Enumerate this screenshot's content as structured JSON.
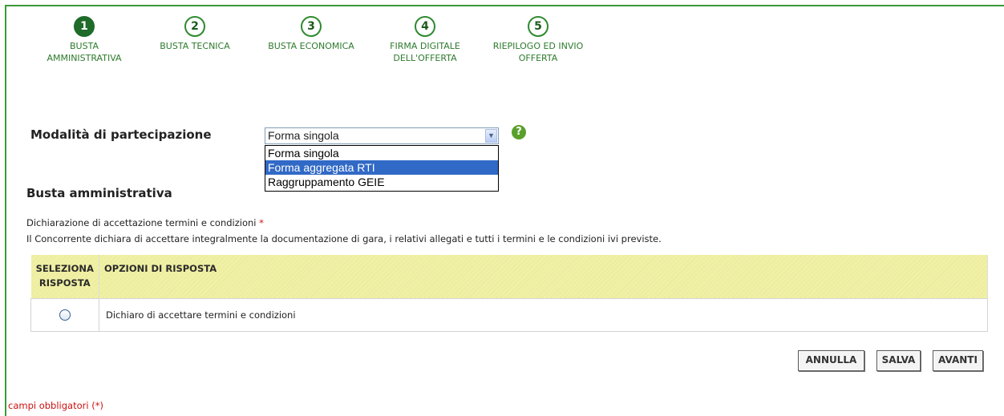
{
  "steps": [
    {
      "number": "1",
      "label": "BUSTA AMMINISTRATIVA",
      "active": true
    },
    {
      "number": "2",
      "label": "BUSTA TECNICA",
      "active": false
    },
    {
      "number": "3",
      "label": "BUSTA ECONOMICA",
      "active": false
    },
    {
      "number": "4",
      "label": "FIRMA DIGITALE DELL'OFFERTA",
      "active": false
    },
    {
      "number": "5",
      "label": "RIEPILOGO ED INVIO OFFERTA",
      "active": false
    }
  ],
  "participation": {
    "label": "Modalità di partecipazione",
    "selected": "Forma singola",
    "options": [
      "Forma singola",
      "Forma aggregata RTI",
      "Raggruppamento GEIE"
    ],
    "highlighted": "Forma aggregata RTI",
    "help_icon": "question-icon"
  },
  "section": {
    "title": "Busta amministrativa",
    "declaration_title": "Dichiarazione di accettazione termini e condizioni",
    "required_mark": "*",
    "declaration_text": "Il Concorrente dichiara di accettare integralmente la documentazione di gara, i relativi allegati e tutti i termini e le condizioni ivi previste."
  },
  "table": {
    "headers": [
      "SELEZIONA RISPOSTA",
      "OPZIONI DI RISPOSTA"
    ],
    "rows": [
      {
        "option": "Dichiaro di accettare termini e condizioni"
      }
    ]
  },
  "buttons": {
    "cancel": "ANNULLA",
    "save": "SALVA",
    "next": "AVANTI"
  },
  "footer": {
    "required_note": "campi obbligatori (*)"
  },
  "colors": {
    "accent_green": "#2f8a2f",
    "header_yellow": "#f0f0a8",
    "required_red": "#cc1111",
    "select_highlight": "#3169c6"
  }
}
